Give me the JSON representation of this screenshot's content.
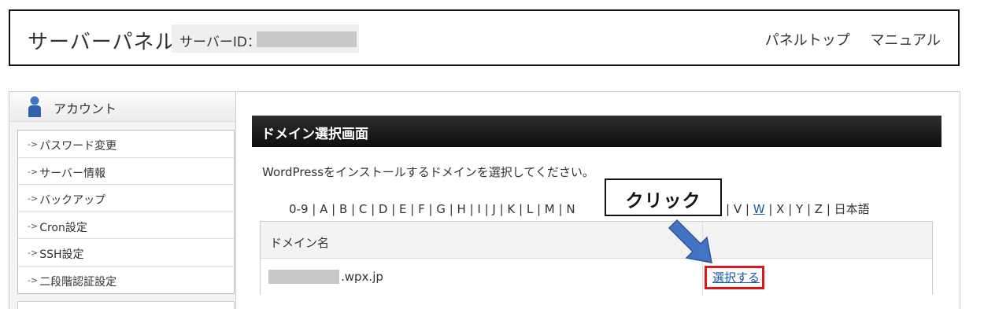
{
  "header": {
    "title": "サーバーパネル",
    "server_id_label": "サーバーID：",
    "links": [
      "パネルトップ",
      "マニュアル"
    ]
  },
  "sidebar": {
    "section_label": "アカウント",
    "items": [
      {
        "label": "パスワード変更"
      },
      {
        "label": "サーバー情報"
      },
      {
        "label": "バックアップ"
      },
      {
        "label": "Cron設定"
      },
      {
        "label": "SSH設定"
      },
      {
        "label": "二段階認証設定"
      }
    ]
  },
  "main": {
    "section_title": "ドメイン選択画面",
    "instruction": "WordPressをインストールするドメインを選択してください。",
    "alpha_nav_left": "0-9 | A | B | C | D | E | F | G | H | I | J | K | L | M | N",
    "alpha_nav_right_prefix": "T | U | V | ",
    "alpha_nav_active": "W",
    "alpha_nav_right_suffix": " | X | Y | Z | 日本語",
    "table": {
      "column_domain": "ドメイン名",
      "rows": [
        {
          "domain_suffix": ".wpx.jp",
          "action_label": "選択する"
        }
      ]
    }
  },
  "annotation": {
    "callout_text": "クリック",
    "highlight_color": "#e0141b",
    "arrow_color": "#4472c4"
  }
}
